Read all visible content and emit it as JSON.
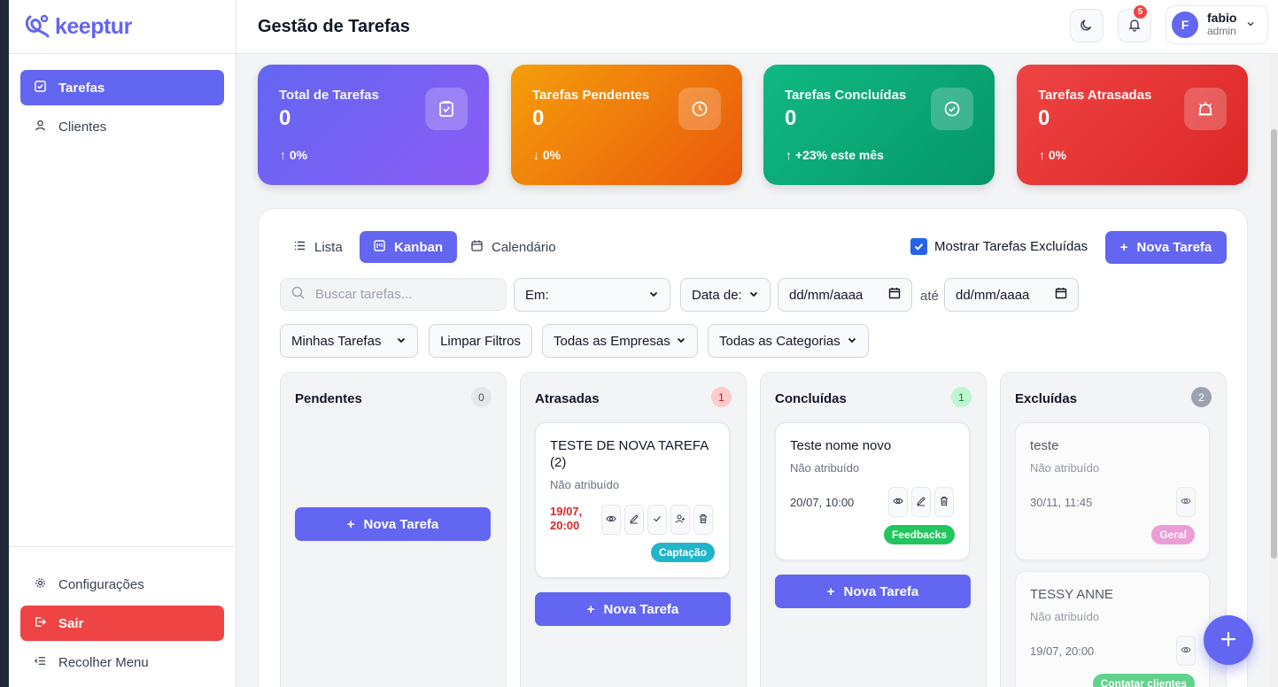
{
  "app": {
    "brand": "keeptur",
    "page_title": "Gestão de Tarefas"
  },
  "sidebar": {
    "items": [
      {
        "label": "Tarefas",
        "icon": "checkbox-icon",
        "active": true
      },
      {
        "label": "Clientes",
        "icon": "user-icon",
        "active": false
      }
    ],
    "bottom": [
      {
        "label": "Configurações",
        "icon": "gear-icon"
      },
      {
        "label": "Sair",
        "icon": "logout-icon"
      },
      {
        "label": "Recolher Menu",
        "icon": "collapse-icon"
      }
    ]
  },
  "header": {
    "notifications_count": "5",
    "user": {
      "initial": "F",
      "name": "fabio",
      "role": "admin"
    }
  },
  "stats": [
    {
      "label": "Total de Tarefas",
      "value": "0",
      "trend": "↑ 0%",
      "icon": "clipboard-check-icon",
      "color": "#6366f1"
    },
    {
      "label": "Tarefas Pendentes",
      "value": "0",
      "trend": "↓ 0%",
      "icon": "clock-icon",
      "color": "#f59e0b"
    },
    {
      "label": "Tarefas Concluídas",
      "value": "0",
      "trend": "↑ +23% este mês",
      "icon": "check-circle-icon",
      "color": "#10b981"
    },
    {
      "label": "Tarefas Atrasadas",
      "value": "0",
      "trend": "↑ 0%",
      "icon": "alarm-icon",
      "color": "#ef4444"
    }
  ],
  "views": {
    "tabs": [
      {
        "label": "Lista"
      },
      {
        "label": "Kanban",
        "active": true
      },
      {
        "label": "Calendário"
      }
    ],
    "show_deleted_label": "Mostrar Tarefas Excluídas",
    "show_deleted_checked": true,
    "new_task_label": "Nova Tarefa"
  },
  "filters": {
    "search_placeholder": "Buscar tarefas...",
    "em_value": "Em:",
    "date_type_value": "Data de:",
    "date_from": "dd/mm/aaaa",
    "until_label": "até",
    "date_to": "dd/mm/aaaa",
    "mine_value": "Minhas Tarefas",
    "clear_label": "Limpar Filtros",
    "companies_value": "Todas as Empresas",
    "categories_value": "Todas as Categorias"
  },
  "kanban": {
    "columns": [
      {
        "title": "Pendentes",
        "count": "0",
        "add_label": "Nova Tarefa",
        "cards": []
      },
      {
        "title": "Atrasadas",
        "count": "1",
        "add_label": "Nova Tarefa",
        "cards": [
          {
            "title": "TESTE DE NOVA TAREFA (2)",
            "assignee": "Não atribuído",
            "date": "19/07, 20:00",
            "tag": "Captação",
            "tag_color": "#22b5c9"
          }
        ]
      },
      {
        "title": "Concluídas",
        "count": "1",
        "add_label": "Nova Tarefa",
        "cards": [
          {
            "title": "Teste nome novo",
            "assignee": "Não atribuído",
            "date": "20/07, 10:00",
            "tag": "Feedbacks",
            "tag_color": "#22c55e"
          }
        ]
      },
      {
        "title": "Excluídas",
        "count": "2",
        "cards": [
          {
            "title": "teste",
            "assignee": "Não atribuído",
            "date": "30/11, 11:45",
            "tag": "Geral",
            "tag_color": "#e879c9"
          },
          {
            "title": "TESSY ANNE",
            "assignee": "Não atribuído",
            "date": "19/07, 20:00",
            "tag": "Contatar clientes",
            "tag_color": "#22c55e"
          }
        ]
      }
    ]
  }
}
